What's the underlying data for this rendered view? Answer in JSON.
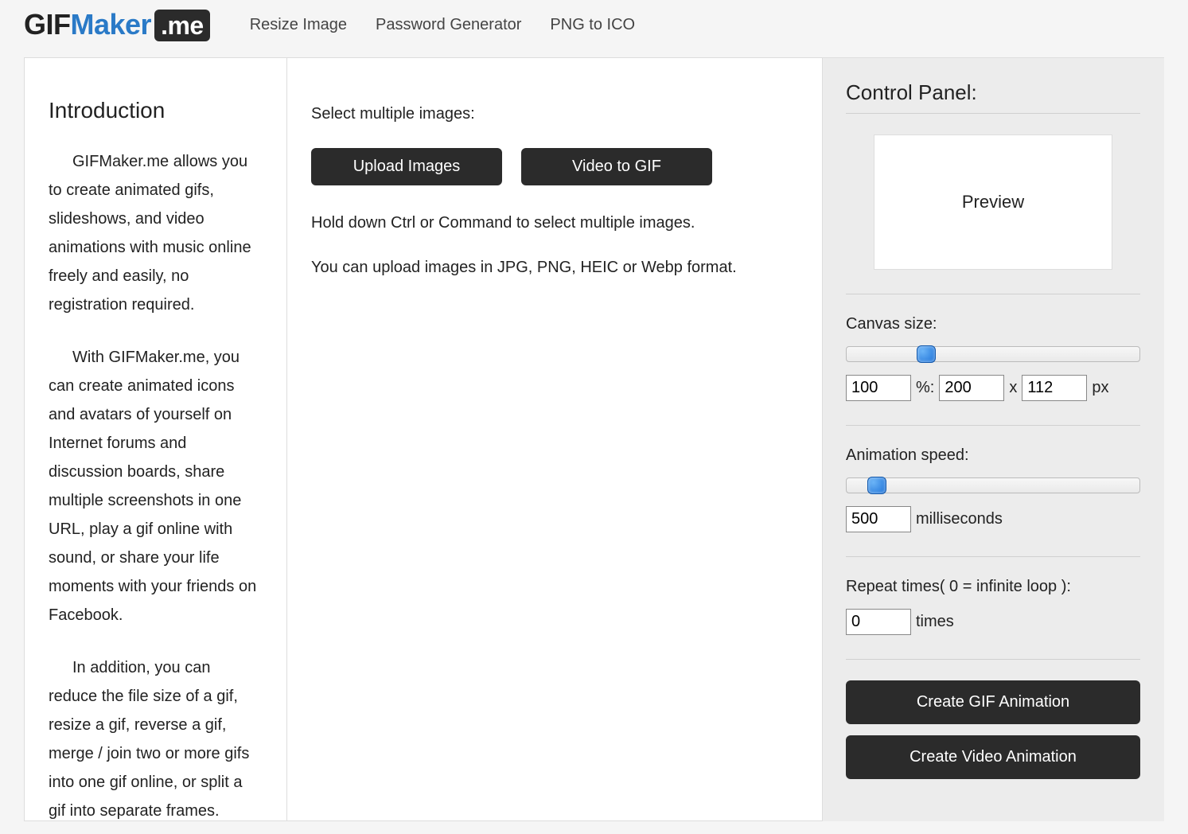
{
  "header": {
    "logo": {
      "part1": "GIF",
      "part2": "Maker",
      "part3": ".me"
    },
    "nav": [
      "Resize Image",
      "Password Generator",
      "PNG to ICO"
    ]
  },
  "sidebar": {
    "heading": "Introduction",
    "paragraphs": [
      "GIFMaker.me allows you to create animated gifs, slideshows, and video animations with music online freely and easily, no registration required.",
      "With GIFMaker.me, you can create animated icons and avatars of yourself on Internet forums and discussion boards, share multiple screenshots in one URL, play a gif online with sound, or share your life moments with your friends on Facebook.",
      "In addition, you can reduce the file size of a gif, resize a gif, reverse a gif, merge / join two or more gifs into one gif online, or split a gif into separate frames."
    ]
  },
  "main": {
    "label": "Select multiple images:",
    "upload_btn": "Upload Images",
    "video_btn": "Video to GIF",
    "help1": "Hold down Ctrl or Command to select multiple images.",
    "help2": "You can upload images in JPG, PNG, HEIC or Webp format."
  },
  "control": {
    "heading": "Control Panel:",
    "preview_label": "Preview",
    "canvas": {
      "label": "Canvas size:",
      "percent_value": "100",
      "percent_unit": "%:",
      "width_value": "200",
      "x": "x",
      "height_value": "112",
      "px": "px",
      "slider_pos_pct": 24
    },
    "speed": {
      "label": "Animation speed:",
      "value": "500",
      "unit": "milliseconds",
      "slider_pos_pct": 7
    },
    "repeat": {
      "label": "Repeat times( 0 = infinite loop ):",
      "value": "0",
      "unit": "times"
    },
    "buttons": {
      "gif": "Create GIF Animation",
      "video": "Create Video Animation"
    }
  }
}
